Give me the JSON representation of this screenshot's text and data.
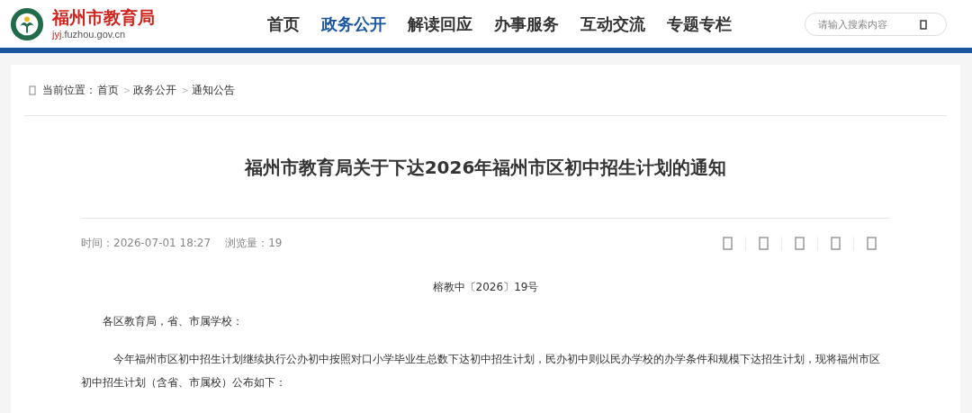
{
  "site": {
    "name": "福州市教育局",
    "domain_prefix": "jyj",
    "domain_rest": ".fuzhou.gov.cn"
  },
  "nav": [
    {
      "label": "首页",
      "selected": false
    },
    {
      "label": "政务公开",
      "selected": true
    },
    {
      "label": "解读回应",
      "selected": false
    },
    {
      "label": "办事服务",
      "selected": false
    },
    {
      "label": "互动交流",
      "selected": false
    },
    {
      "label": "专题专栏",
      "selected": false
    }
  ],
  "search": {
    "placeholder": "请输入搜索内容"
  },
  "breadcrumb": {
    "label": "当前位置：",
    "items": [
      {
        "text": "首页",
        "separator": ">"
      },
      {
        "text": "政务公开",
        "separator": ">"
      },
      {
        "text": "通知公告"
      }
    ]
  },
  "article": {
    "title": "福州市教育局关于下达2026年福州市区初中招生计划的通知",
    "time": "时间：2026-07-01 18:27",
    "views": "浏览量：19",
    "doc_number": "榕教中〔2026〕19号",
    "paragraphs": [
      {
        "kind": "salutation",
        "text": "各区教育局，省、市属学校："
      },
      {
        "kind": "body",
        "text": "今年福州市区初中招生计划继续执行公办初中按照对口小学毕业生总数下达初中招生计划，民办初中则以民办学校的办学条件和规模下达招生计划，现将福州市区初中招生计划（含省、市属校）公布如下："
      }
    ]
  }
}
